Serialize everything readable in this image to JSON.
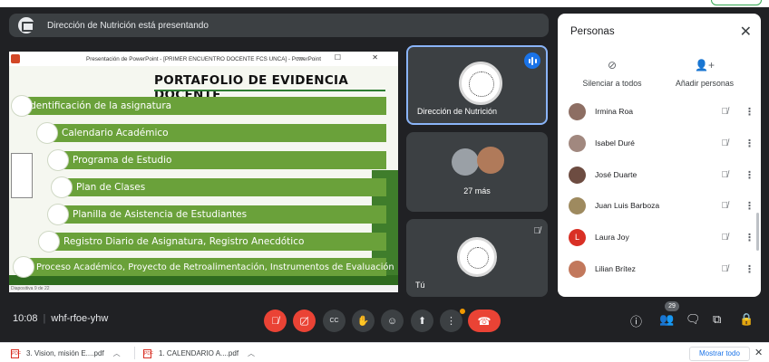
{
  "banner": {
    "text": "Dirección de Nutrición está presentando"
  },
  "presentation": {
    "window_title": "Presentación de PowerPoint - [PRIMER ENCUENTRO DOCENTE FCS UNCA] - PowerPoint",
    "window_controls": "— ☐ ✕",
    "slide_title": "PORTAFOLIO DE EVIDENCIA DOCENTE",
    "items": [
      "Identificación de la asignatura",
      "Calendario Académico",
      "Programa de Estudio",
      "Plan de Clases",
      "Planilla de Asistencia de Estudiantes",
      "Registro Diario de Asignatura, Registro Anecdótico",
      "Proceso Académico, Proyecto de Retroalimentación, Instrumentos de Evaluación"
    ],
    "status": "Diapositiva 9 de 22"
  },
  "tiles": {
    "presenter_name": "Dirección de Nutrición",
    "more_count": "27 más",
    "self_name": "Tú"
  },
  "people_panel": {
    "title": "Personas",
    "mute_all": "Silenciar a todos",
    "add_people": "Añadir personas",
    "participants": [
      {
        "name": "Irmina Roa",
        "color": "#8d6e63"
      },
      {
        "name": "Isabel Duré",
        "color": "#a1887f"
      },
      {
        "name": "José Duarte",
        "color": "#6d4c41"
      },
      {
        "name": "Juan Luis Barboza",
        "color": "#9e8a5f"
      },
      {
        "name": "Laura Joy",
        "initial": "L",
        "color": "#d93025"
      },
      {
        "name": "Lilian Brítez",
        "color": "#c2785c"
      }
    ]
  },
  "controls": {
    "time": "10:08",
    "meeting_code": "whf-rfoe-yhw",
    "participant_badge": "29"
  },
  "downloads": {
    "files": [
      "3. Vision, misión E....pdf",
      "1. CALENDARIO A....pdf"
    ],
    "show_all": "Mostrar todo"
  },
  "colors": {
    "accent_red": "#ea4335",
    "active_border": "#8ab4f8",
    "slide_green": "#6aa13a"
  }
}
